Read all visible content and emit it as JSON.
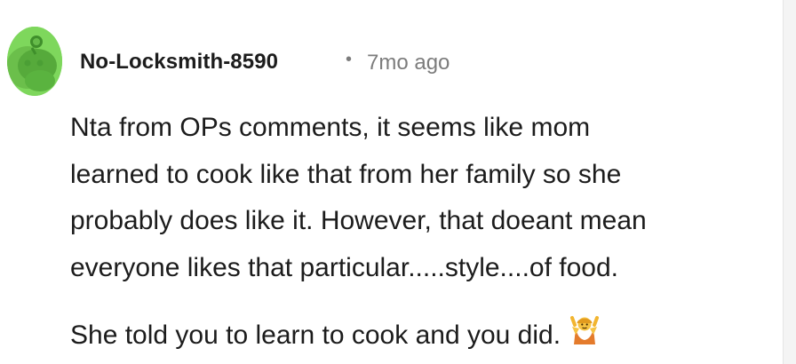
{
  "comment": {
    "author": "No-Locksmith-8590",
    "separator": "•",
    "timestamp": "7mo ago",
    "paragraphs": [
      {
        "lines": [
          "Nta from OPs comments, it seems like mom",
          "learned to cook like that from her family so she",
          "probably does like it. However, that doeant mean",
          "everyone likes that particular.....style....of food."
        ]
      },
      {
        "lines": [
          "She told you to learn to cook and you did."
        ]
      }
    ],
    "emoji": "person-shrugging-emoji"
  },
  "colors": {
    "avatar_bg": "#7ed75c",
    "text": "#1c1c1c",
    "meta": "#7c7c7c",
    "emoji": "#f2b530"
  }
}
